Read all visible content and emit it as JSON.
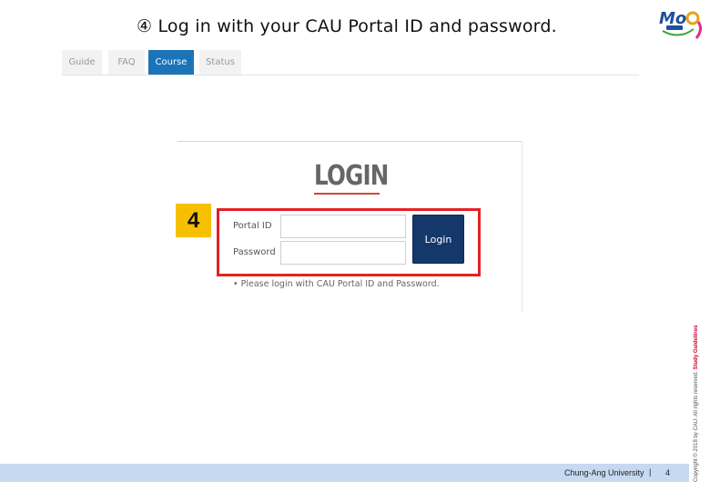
{
  "heading": {
    "text": "④ Log in with your CAU Portal ID and password."
  },
  "logo": {
    "name": "cau-mooc-logo"
  },
  "tabs": [
    {
      "label": "Guide",
      "active": false
    },
    {
      "label": "FAQ",
      "active": false
    },
    {
      "label": "Course",
      "active": true
    },
    {
      "label": "Status",
      "active": false
    }
  ],
  "login": {
    "title": "LOGIN",
    "step_number": "4",
    "portal_id_label": "Portal ID",
    "password_label": "Password",
    "portal_id_value": "",
    "password_value": "",
    "button_label": "Login",
    "note": "• Please login with CAU Portal ID and Password."
  },
  "side": {
    "copyright": "Copyright © 2018 by CAU. All rights reserved. ",
    "brand": "Study Guidelines"
  },
  "footer": {
    "university": "Chung-Ang University",
    "separator": "|",
    "page_number": "4"
  },
  "colors": {
    "tab_active": "#1b73b8",
    "highlight_border": "#e52124",
    "step_badge": "#f6c000",
    "login_button": "#15386a",
    "footer_bar": "#c6d9f0"
  }
}
